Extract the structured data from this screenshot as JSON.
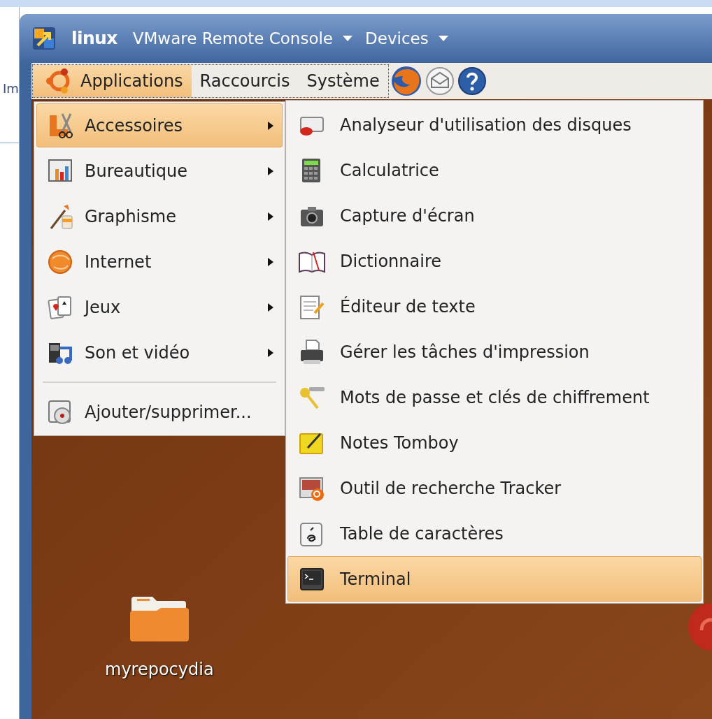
{
  "background_text": "Im",
  "window": {
    "title": "linux",
    "menus": [
      {
        "label": "VMware Remote Console"
      },
      {
        "label": "Devices"
      }
    ]
  },
  "panel": {
    "menus": [
      {
        "label": "Applications",
        "selected": true
      },
      {
        "label": "Raccourcis",
        "selected": false
      },
      {
        "label": "Système",
        "selected": false
      }
    ]
  },
  "applications_menu": {
    "items": [
      {
        "kind": "submenu",
        "label": "Accessoires",
        "selected": true
      },
      {
        "kind": "submenu",
        "label": "Bureautique",
        "selected": false
      },
      {
        "kind": "submenu",
        "label": "Graphisme",
        "selected": false
      },
      {
        "kind": "submenu",
        "label": "Internet",
        "selected": false
      },
      {
        "kind": "submenu",
        "label": "Jeux",
        "selected": false
      },
      {
        "kind": "submenu",
        "label": "Son et vidéo",
        "selected": false
      },
      {
        "kind": "separator"
      },
      {
        "kind": "item",
        "label": "Ajouter/supprimer...",
        "selected": false
      }
    ]
  },
  "accessories_menu": {
    "items": [
      {
        "label": "Analyseur d'utilisation des disques",
        "selected": false
      },
      {
        "label": "Calculatrice",
        "selected": false
      },
      {
        "label": "Capture d'écran",
        "selected": false
      },
      {
        "label": "Dictionnaire",
        "selected": false
      },
      {
        "label": "Éditeur de texte",
        "selected": false
      },
      {
        "label": "Gérer les tâches d'impression",
        "selected": false
      },
      {
        "label": "Mots de passe et clés de chiffrement",
        "selected": false
      },
      {
        "label": "Notes Tomboy",
        "selected": false
      },
      {
        "label": "Outil de recherche Tracker",
        "selected": false
      },
      {
        "label": "Table de caractères",
        "selected": false
      },
      {
        "label": "Terminal",
        "selected": true
      }
    ]
  },
  "desktop": {
    "icons": [
      {
        "label": "myrepocydia"
      }
    ]
  }
}
